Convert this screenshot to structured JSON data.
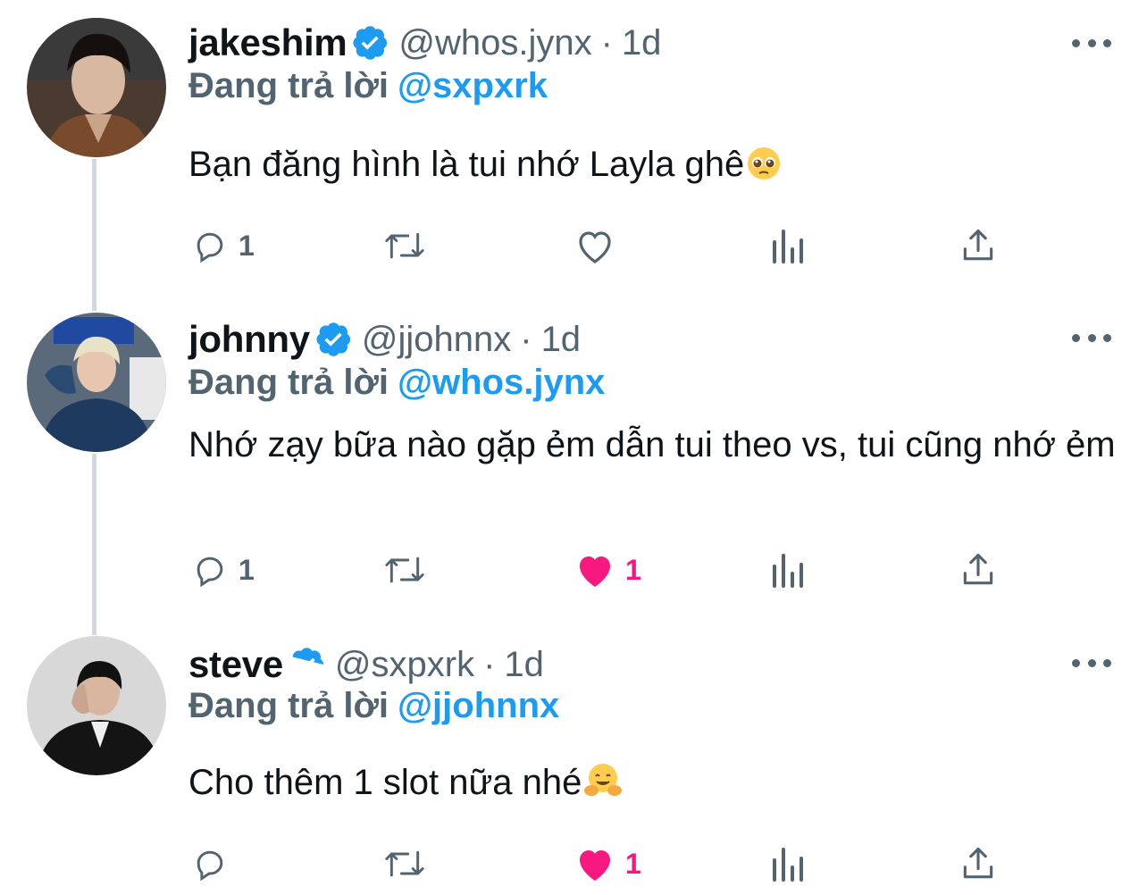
{
  "thread": [
    {
      "name": "jakeshim",
      "handle": "@whos.jynx",
      "separator": "·",
      "time": "1d",
      "reply_prefix": "Đang trả lời",
      "reply_to": "@sxpxrk",
      "text": "Bạn đăng hình là tui nhớ Layla ghê",
      "emoji": "pleading-face",
      "actions": {
        "reply_count": "1",
        "retweet_count": "",
        "like_count": "",
        "liked": false
      }
    },
    {
      "name": "johnny",
      "handle": "@jjohnnx",
      "separator": "·",
      "time": "1d",
      "reply_prefix": "Đang trả lời",
      "reply_to": "@whos.jynx",
      "text": "Nhớ zạy bữa nào gặp ẻm dẫn tui theo vs, tui cũng nhớ ẻm",
      "actions": {
        "reply_count": "1",
        "retweet_count": "",
        "like_count": "1",
        "liked": true
      }
    },
    {
      "name": "steve",
      "handle": "@sxpxrk",
      "separator": "·",
      "time": "1d",
      "reply_prefix": "Đang trả lời",
      "reply_to": "@jjohnnx",
      "text": "Cho thêm 1 slot nữa nhé",
      "emoji": "hugging-face",
      "actions": {
        "reply_count": "",
        "retweet_count": "",
        "like_count": "1",
        "liked": true
      }
    }
  ],
  "colors": {
    "text": "#0f1419",
    "secondary": "#536471",
    "accent": "#1d9bf0",
    "like": "#f91880",
    "thread_line": "#cfd9de"
  }
}
